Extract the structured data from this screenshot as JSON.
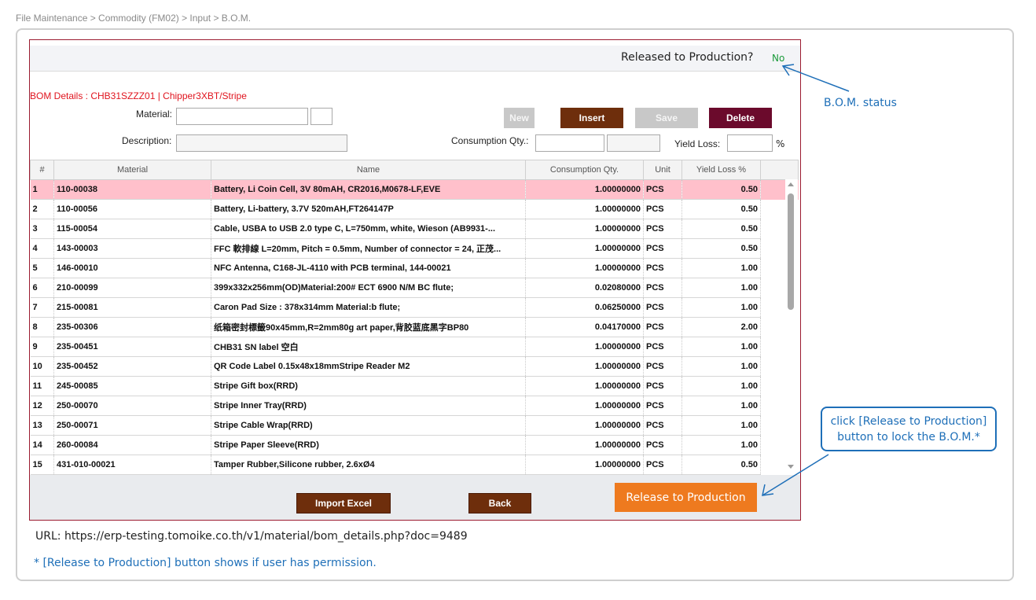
{
  "breadcrumb": "File Maintenance > Commodity (FM02) > Input > B.O.M.",
  "released": {
    "label": "Released to Production?",
    "value": "No"
  },
  "bom_title": "BOM Details : CHB31SZZZ01 | Chipper3XBT/Stripe",
  "form": {
    "material_label": "Material:",
    "description_label": "Description:",
    "consumption_label": "Consumption Qty.:",
    "yield_label": "Yield Loss:",
    "percent": "%"
  },
  "buttons": {
    "new": "New",
    "insert": "Insert",
    "save": "Save",
    "delete": "Delete",
    "import_excel": "Import Excel",
    "back": "Back",
    "release": "Release to Production"
  },
  "table": {
    "headers": [
      "#",
      "Material",
      "Name",
      "Consumption Qty.",
      "Unit",
      "Yield Loss %"
    ],
    "rows": [
      [
        "1",
        "110-00038",
        "Battery, Li Coin Cell, 3V 80mAH, CR2016,M0678-LF,EVE",
        "1.00000000",
        "PCS",
        "0.50"
      ],
      [
        "2",
        "110-00056",
        "Battery, Li-battery, 3.7V 520mAH,FT264147P",
        "1.00000000",
        "PCS",
        "0.50"
      ],
      [
        "3",
        "115-00054",
        "Cable, USBA to USB 2.0 type C, L=750mm, white, Wieson (AB9931-...",
        "1.00000000",
        "PCS",
        "0.50"
      ],
      [
        "4",
        "143-00003",
        "FFC 軟排線 L=20mm, Pitch = 0.5mm, Number of connector = 24, 正茂...",
        "1.00000000",
        "PCS",
        "0.50"
      ],
      [
        "5",
        "146-00010",
        "NFC Antenna, C168-JL-4110 with PCB terminal, 144-00021",
        "1.00000000",
        "PCS",
        "1.00"
      ],
      [
        "6",
        "210-00099",
        "399x332x256mm(OD)Material:200# ECT 6900 N/M BC flute;",
        "0.02080000",
        "PCS",
        "1.00"
      ],
      [
        "7",
        "215-00081",
        "Caron Pad Size : 378x314mm Material:b flute;",
        "0.06250000",
        "PCS",
        "1.00"
      ],
      [
        "8",
        "235-00306",
        "纸箱密封標籤90x45mm,R=2mm80g art paper,背胶蓝底黑字BP80",
        "0.04170000",
        "PCS",
        "2.00"
      ],
      [
        "9",
        "235-00451",
        "CHB31 SN label 空白",
        "1.00000000",
        "PCS",
        "1.00"
      ],
      [
        "10",
        "235-00452",
        "QR Code Label 0.15x48x18mmStripe Reader M2",
        "1.00000000",
        "PCS",
        "1.00"
      ],
      [
        "11",
        "245-00085",
        "Stripe Gift box(RRD)",
        "1.00000000",
        "PCS",
        "1.00"
      ],
      [
        "12",
        "250-00070",
        "Stripe Inner Tray(RRD)",
        "1.00000000",
        "PCS",
        "1.00"
      ],
      [
        "13",
        "250-00071",
        "Stripe Cable Wrap(RRD)",
        "1.00000000",
        "PCS",
        "1.00"
      ],
      [
        "14",
        "260-00084",
        "Stripe Paper Sleeve(RRD)",
        "1.00000000",
        "PCS",
        "1.00"
      ],
      [
        "15",
        "431-010-00021",
        "Tamper Rubber,Silicone rubber, 2.6xØ4",
        "1.00000000",
        "PCS",
        "0.50"
      ]
    ]
  },
  "annotations": {
    "bom_status": "B.O.M. status",
    "callout_line1": "click [Release to Production]",
    "callout_line2": "button to lock the B.O.M.*",
    "url": "URL: https://erp-testing.tomoike.co.th/v1/material/bom_details.php?doc=9489",
    "permission_note": "* [Release to Production] button shows if user has permission."
  },
  "colors": {
    "accent_brown": "#6e2e0c",
    "delete": "#6b0a2c",
    "release": "#ee7a1f",
    "selected_row": "#ffc0cb",
    "annotation": "#1e6fb8"
  }
}
